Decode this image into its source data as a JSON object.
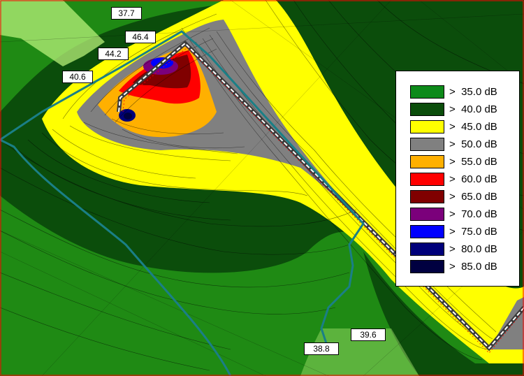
{
  "value_labels": [
    {
      "id": "37-7",
      "text": "37.7"
    },
    {
      "id": "46-4",
      "text": "46.4"
    },
    {
      "id": "44-2",
      "text": "44.2"
    },
    {
      "id": "40-6",
      "text": "40.6"
    },
    {
      "id": "39-6",
      "text": "39.6"
    },
    {
      "id": "38-8",
      "text": "38.8"
    }
  ],
  "legend": {
    "items": [
      {
        "label": ">  35.0 dB",
        "color": "#0d8a1a"
      },
      {
        "label": ">  40.0 dB",
        "color": "#0b4d0b"
      },
      {
        "label": ">  45.0 dB",
        "color": "#ffff00"
      },
      {
        "label": ">  50.0 dB",
        "color": "#808080"
      },
      {
        "label": ">  55.0 dB",
        "color": "#ffb000"
      },
      {
        "label": ">  60.0 dB",
        "color": "#ff0000"
      },
      {
        "label": ">  65.0 dB",
        "color": "#800000"
      },
      {
        "label": ">  70.0 dB",
        "color": "#7b007b"
      },
      {
        "label": ">  75.0 dB",
        "color": "#0000ff"
      },
      {
        "label": ">  80.0 dB",
        "color": "#00007a"
      },
      {
        "label": ">  85.0 dB",
        "color": "#000040"
      }
    ]
  },
  "colors": {
    "boundary_line": "#1a7f86",
    "road_marking": "#ffffff",
    "contour_line": "#000000",
    "frame": "#ff0000"
  }
}
